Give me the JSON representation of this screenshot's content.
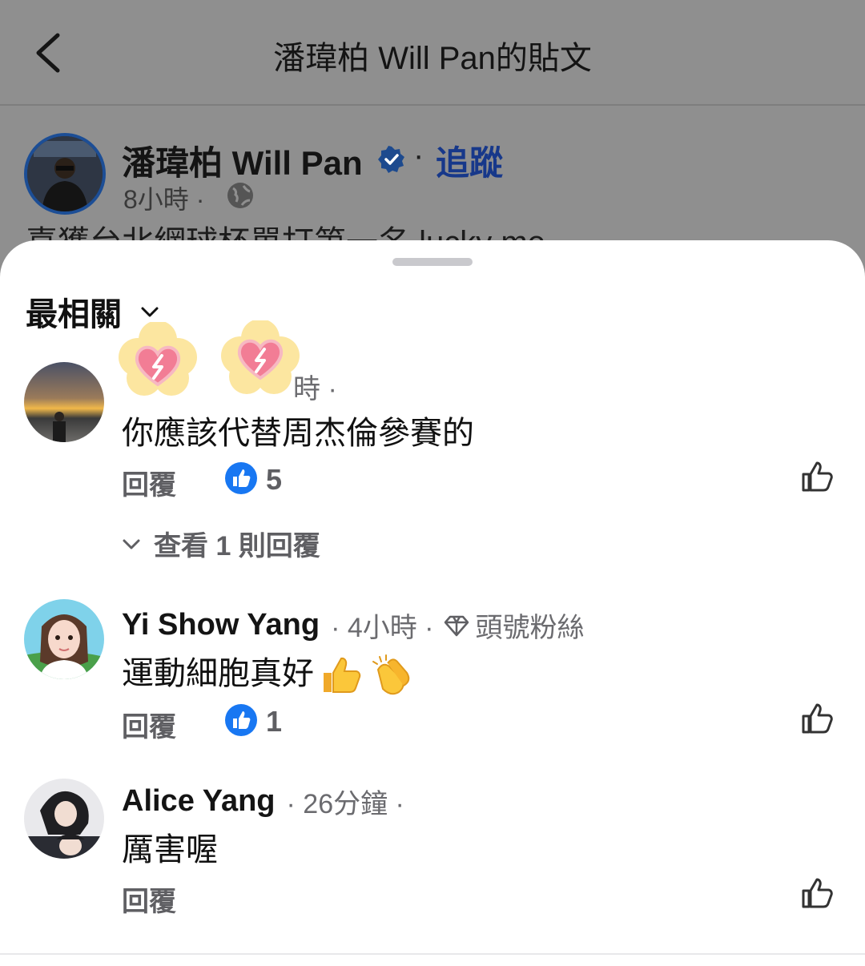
{
  "header": {
    "title": "潘瑋柏 Will Pan的貼文",
    "back_icon": "chevron-left-icon"
  },
  "post": {
    "author": "潘瑋柏 Will Pan",
    "separator": "·",
    "follow_label": "追蹤",
    "time": "8小時 ·",
    "text": "喜獲台北網球杯單打第一名 lucky me",
    "verified_color": "#1877F2"
  },
  "sheet": {
    "sort_label": "最相關"
  },
  "comments": [
    {
      "name_visible": "",
      "time": "時 ·",
      "text": "你應該代替周杰倫參賽的",
      "reply_label": "回覆",
      "likes": "5",
      "view_replies": "查看 1 則回覆"
    },
    {
      "name": "Yi Show Yang",
      "time": "· 4小時 ·",
      "badge": "頭號粉絲",
      "text": "運動細胞真好",
      "reply_label": "回覆",
      "likes": "1"
    },
    {
      "name": "Alice Yang",
      "time": "· 26分鐘 ·",
      "text": "厲害喔",
      "reply_label": "回覆"
    }
  ],
  "colors": {
    "like_blue": "#1877F2",
    "follow_blue": "#17388A",
    "sticker_pink": "#F27D95",
    "sticker_yellow": "#FCE6A0"
  }
}
